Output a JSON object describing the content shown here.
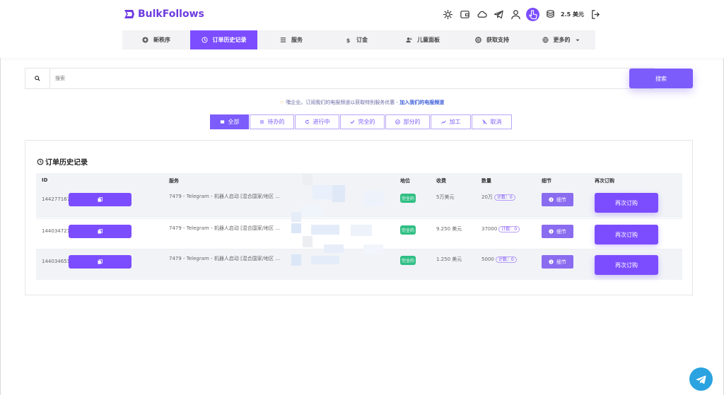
{
  "brand": {
    "name": "BulkFollows",
    "color": "#6d3be0"
  },
  "header": {
    "icons": [
      "sparkle-icon",
      "wallet-icon",
      "cloud-icon",
      "telegram-icon",
      "user-icon",
      "pointer-icon",
      "coins-icon"
    ],
    "balance": "2.5 美元",
    "logout_icon": "logout-icon"
  },
  "nav": {
    "items": [
      {
        "label": "新秩序",
        "icon": "plus-circle-icon",
        "active": false
      },
      {
        "label": "订单历史记录",
        "icon": "history-icon",
        "active": true
      },
      {
        "label": "服务",
        "icon": "list-icon",
        "active": false
      },
      {
        "label": "订金",
        "icon": "dollar-icon",
        "active": false
      },
      {
        "label": "儿童面板",
        "icon": "users-icon",
        "active": false
      },
      {
        "label": "获取支持",
        "icon": "lifebuoy-icon",
        "active": false
      },
      {
        "label": "更多的",
        "icon": "globe-icon",
        "active": false
      }
    ]
  },
  "search": {
    "placeholder": "搜索",
    "button_label": "搜索"
  },
  "promo": {
    "text": "嘿企业。订阅我们的电报频道以获取特别服务优惠 -",
    "link": "加入我们的电报频道"
  },
  "filters": [
    {
      "label": "全部",
      "active": true
    },
    {
      "label": "待办的",
      "active": false
    },
    {
      "label": "进行中",
      "active": false
    },
    {
      "label": "完全的",
      "active": false
    },
    {
      "label": "部分的",
      "active": false
    },
    {
      "label": "加工",
      "active": false
    },
    {
      "label": "取消",
      "active": false
    }
  ],
  "orders": {
    "title": "订单历史记录",
    "columns": [
      "ID",
      "服务",
      "地位",
      "收费",
      "数量",
      "细节",
      "再次订购"
    ],
    "rows": [
      {
        "id": "144277167",
        "service": "7479 - Telegram - 机器人启动 [混合国家/地区 ...",
        "status": "完全的",
        "charge": "5万美元",
        "quantity": "20万",
        "count": "计数：0",
        "detail": "细节",
        "reorder": "再次订购"
      },
      {
        "id": "144034721",
        "service": "7479 - Telegram - 机器人启动 [混合国家/地区 ...",
        "status": "完全的",
        "charge": "9.250 美元",
        "quantity": "37000",
        "count": "计数：0",
        "detail": "细节",
        "reorder": "再次订购"
      },
      {
        "id": "144034651",
        "service": "7479 - Telegram - 机器人启动 [混合国家/地区 ...",
        "status": "完全的",
        "charge": "1.250 美元",
        "quantity": "5000",
        "count": "计数：0",
        "detail": "细节",
        "reorder": "再次订购"
      }
    ]
  },
  "colors": {
    "accent": "#7c4dff",
    "success": "#2fbf83",
    "telegram": "#2aa3e0"
  }
}
